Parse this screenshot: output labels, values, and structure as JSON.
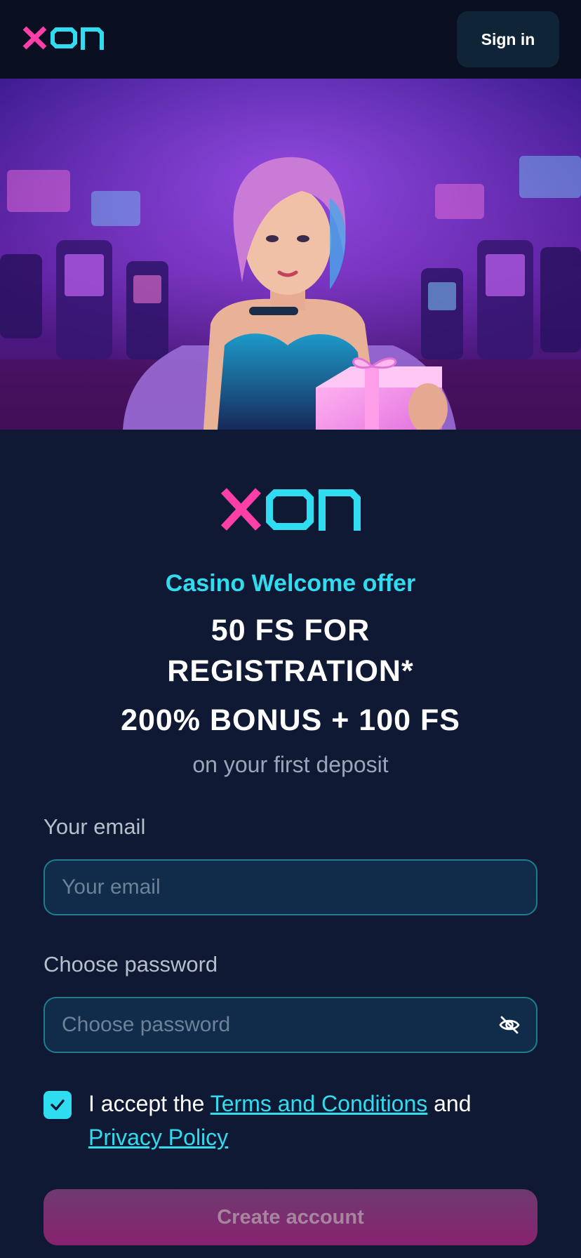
{
  "header": {
    "logo_alt": "XON",
    "signin_label": "Sign in"
  },
  "promo": {
    "welcome": "Casino Welcome offer",
    "line1": "50 FS FOR REGISTRATION*",
    "line2": "200% BONUS + 100 FS",
    "subtitle": "on your first deposit"
  },
  "form": {
    "email_label": "Your email",
    "email_placeholder": "Your email",
    "email_value": "",
    "password_label": "Choose password",
    "password_placeholder": "Choose password",
    "password_value": "",
    "terms_prefix": "I accept the",
    "terms_link": "Terms and Conditions",
    "terms_mid": "and",
    "privacy_link": "Privacy Policy",
    "terms_checked": true,
    "submit_label": "Create account"
  },
  "colors": {
    "accent_cyan": "#2fdcf0",
    "accent_pink": "#ff3fa8",
    "background": "#0f1933"
  },
  "icons": [
    "xon-logo",
    "eye-off-icon",
    "check-icon"
  ]
}
